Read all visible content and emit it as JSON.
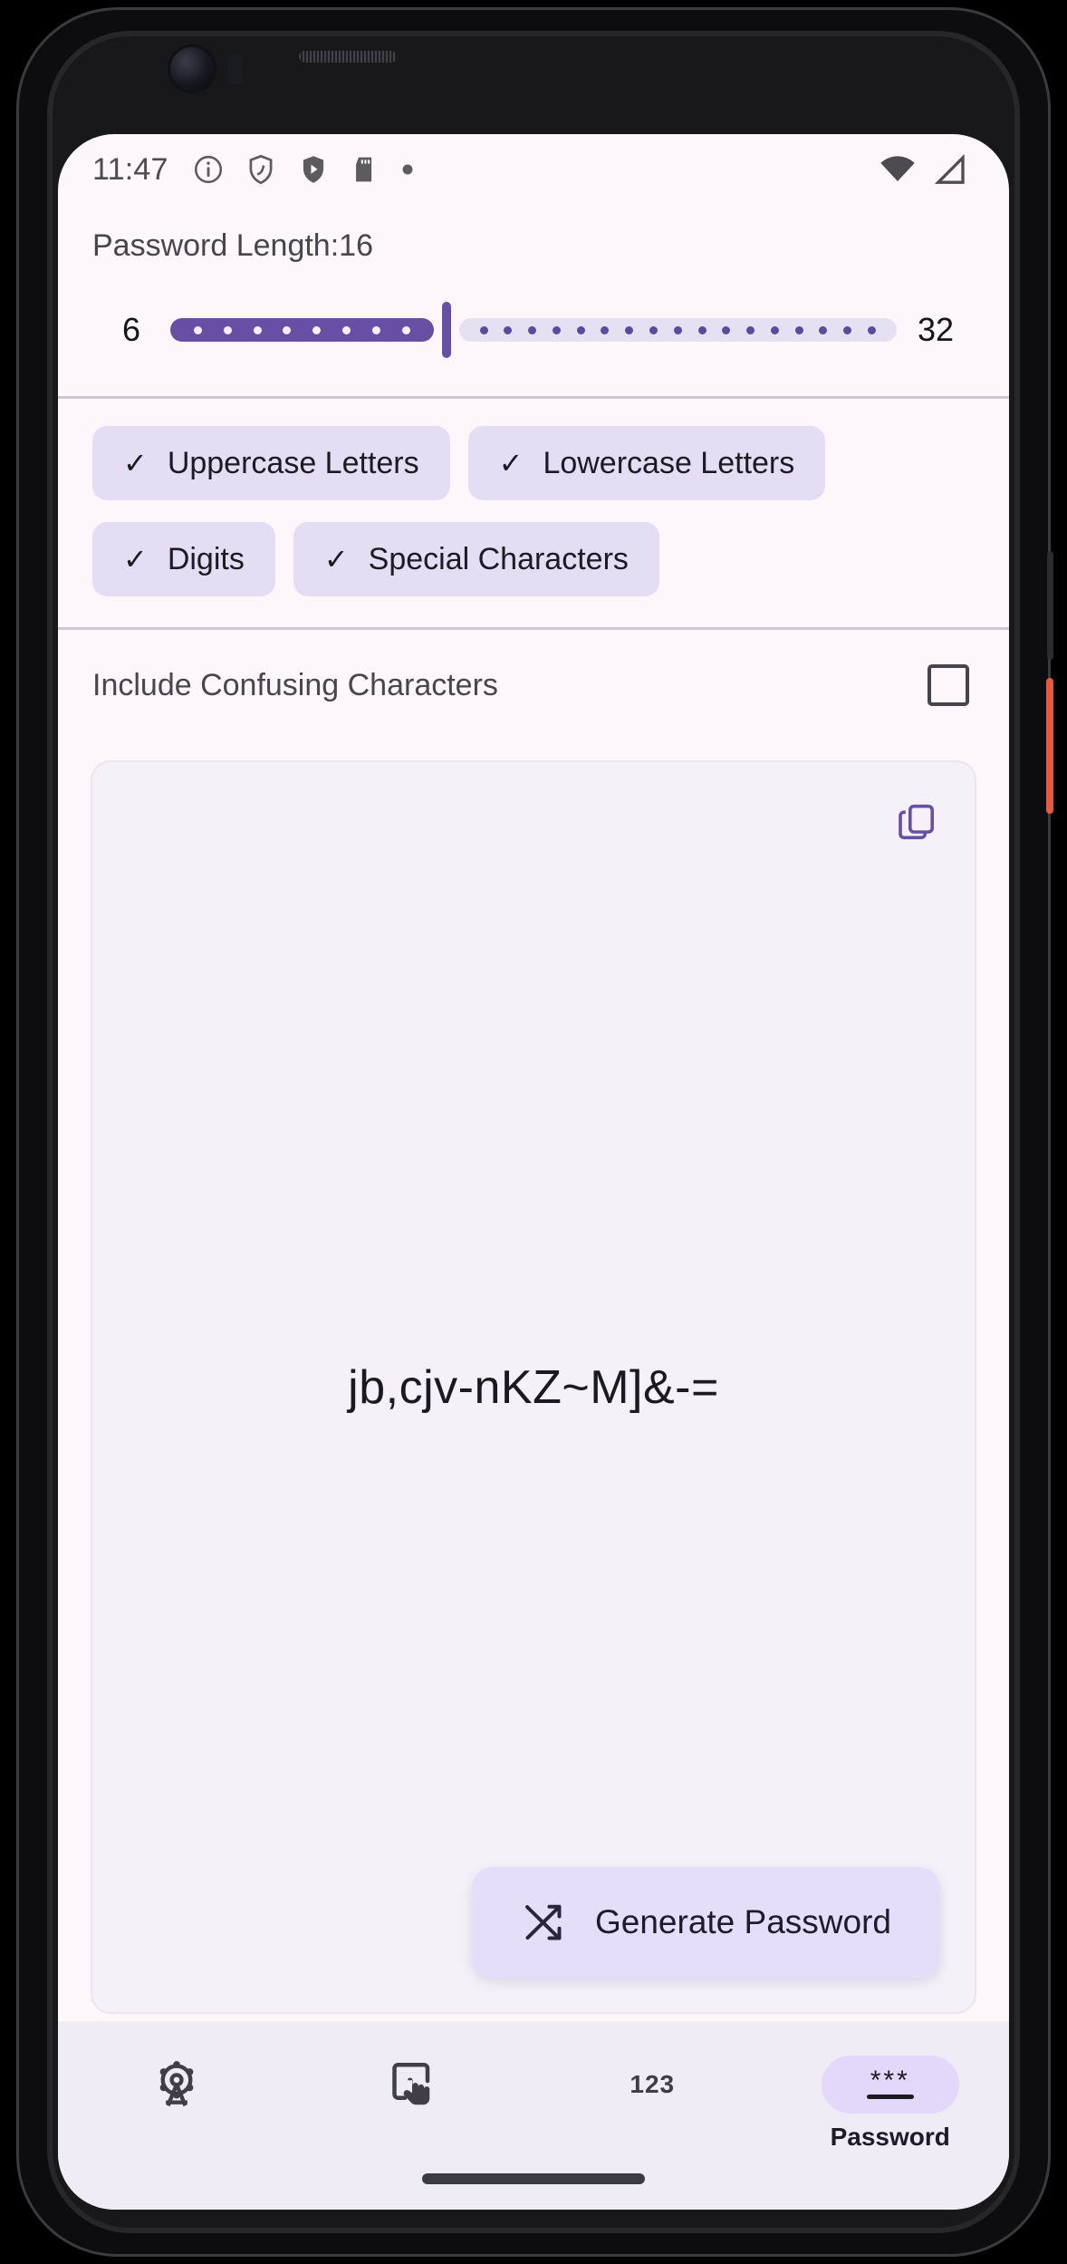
{
  "status_bar": {
    "clock": "11:47",
    "left_icons": [
      "info-circle-icon",
      "shield-outline-icon",
      "shield-play-icon",
      "sd-card-icon",
      "dot-icon"
    ],
    "right_icons": [
      "wifi-icon",
      "cellular-signal-icon"
    ]
  },
  "length_section": {
    "label": "Password Length:16",
    "value": 16,
    "min_label": "6",
    "max_label": "32",
    "min": 6,
    "max": 32,
    "active_ticks": 8,
    "inactive_ticks": 17,
    "fill_percent": 38,
    "accent_color": "#6750a4",
    "inactive_track_color": "#e7e0f3"
  },
  "charset_section": {
    "check_glyph": "✓",
    "rows": [
      [
        {
          "label": "Uppercase Letters",
          "checked": true
        },
        {
          "label": "Lowercase Letters",
          "checked": true
        }
      ],
      [
        {
          "label": "Digits",
          "checked": true
        },
        {
          "label": "Special Characters",
          "checked": true
        }
      ]
    ]
  },
  "confusing_row": {
    "label": "Include Confusing Characters",
    "checked": false
  },
  "password_card": {
    "value": "jb,cjv-nKZ~M]&-=",
    "copy_icon": "copy-icon",
    "generate_label": "Generate Password",
    "generate_icon": "shuffle-icon",
    "card_bg": "#f6f1f8",
    "button_bg": "#e6ddfb"
  },
  "bottom_nav": {
    "items": [
      {
        "icon": "ferris-wheel-icon",
        "label": "",
        "active": false
      },
      {
        "icon": "tap-gesture-icon",
        "label": "",
        "active": false
      },
      {
        "icon": "digits-123-icon",
        "text": "123",
        "label": "",
        "active": false
      },
      {
        "icon": "password-asterisks-icon",
        "label": "Password",
        "active": true
      }
    ],
    "active_pill_color": "#e3d8fa",
    "bar_bg": "#f0ecf5"
  }
}
